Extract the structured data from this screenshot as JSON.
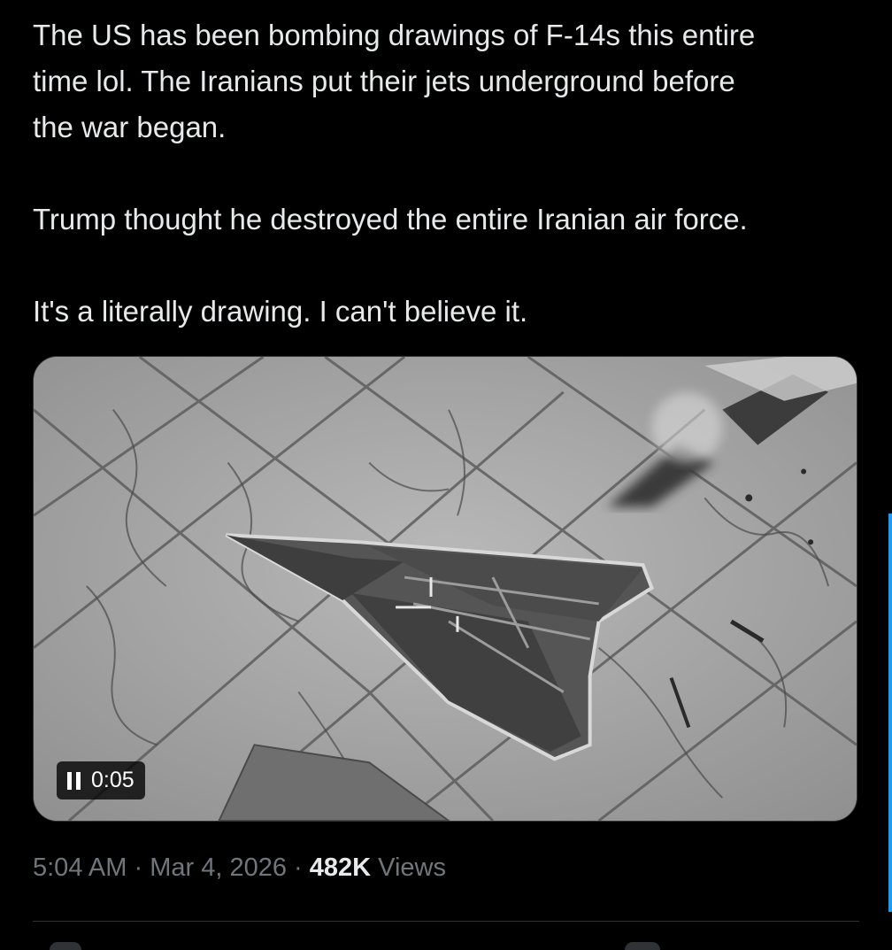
{
  "tweet": {
    "paragraphs": [
      "The US has been bombing drawings of F-14s this entire time lol. The Iranians put their jets underground before the war began.",
      "Trump thought he destroyed the entire Iranian air force.",
      "It's a literally drawing. I can't believe it."
    ],
    "lines": [
      "The US has been bombing drawings of F-14s this entire",
      "time lol. The Iranians put their jets underground before",
      "the war began."
    ]
  },
  "media": {
    "type": "video",
    "state": "playing",
    "control_icon": "pause-icon",
    "timestamp": "0:05"
  },
  "meta": {
    "time": "5:04 AM",
    "separator": "·",
    "date": "Mar 4, 2026",
    "views_count": "482K",
    "views_label": "Views"
  },
  "colors": {
    "background": "#000000",
    "text": "#e7e9ea",
    "secondary_text": "#71767b",
    "divider": "#2f3336",
    "accent": "#1d9bf0"
  }
}
